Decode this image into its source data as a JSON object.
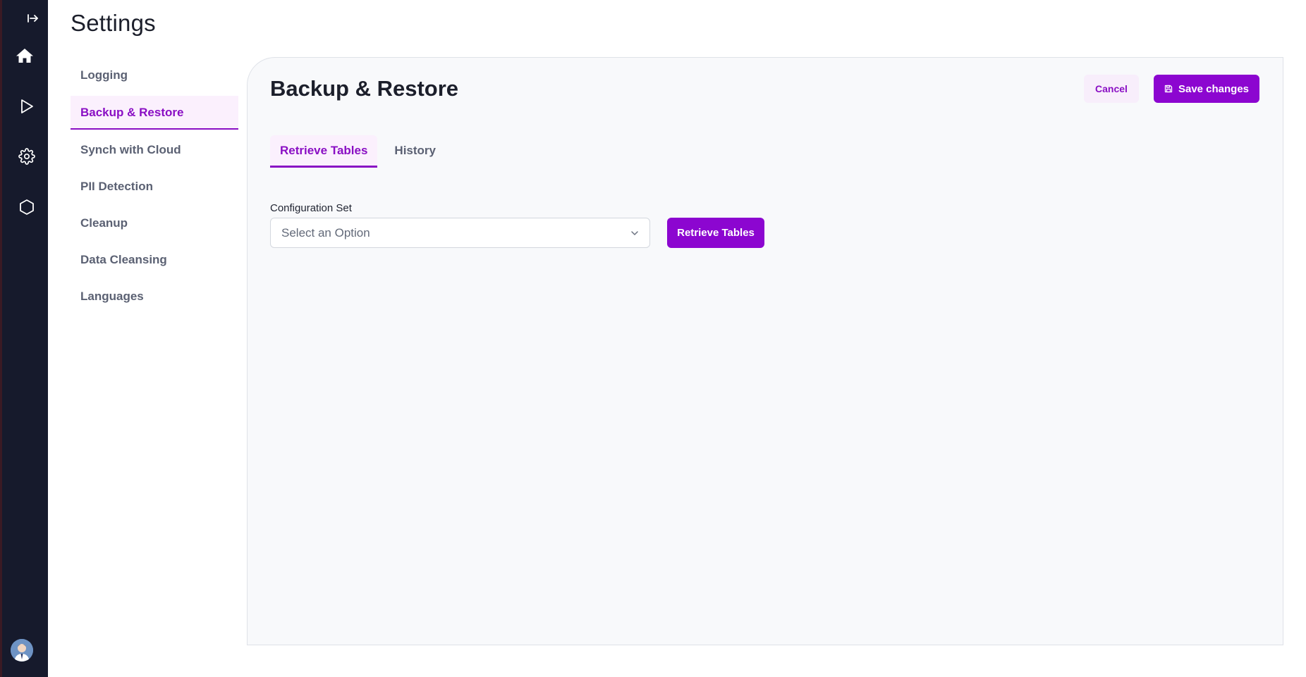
{
  "page": {
    "title": "Settings"
  },
  "rail": {
    "icons": [
      "expand-icon",
      "home-icon",
      "play-icon",
      "gear-icon",
      "hexagon-icon",
      "user-avatar"
    ]
  },
  "settings_nav": {
    "items": [
      {
        "label": "Logging",
        "active": false
      },
      {
        "label": "Backup & Restore",
        "active": true
      },
      {
        "label": "Synch with Cloud",
        "active": false
      },
      {
        "label": "PII Detection",
        "active": false
      },
      {
        "label": "Cleanup",
        "active": false
      },
      {
        "label": "Data Cleansing",
        "active": false
      },
      {
        "label": "Languages",
        "active": false
      }
    ]
  },
  "panel": {
    "title": "Backup & Restore",
    "cancel_label": "Cancel",
    "save_label": "Save changes",
    "tabs": [
      {
        "label": "Retrieve Tables",
        "active": true
      },
      {
        "label": "History",
        "active": false
      }
    ],
    "config_set": {
      "label": "Configuration Set",
      "placeholder": "Select an Option"
    },
    "retrieve_label": "Retrieve Tables"
  },
  "colors": {
    "accent": "#8c06d0",
    "accent_soft": "#fbf0fd",
    "rail_bg": "#161a2c",
    "panel_bg": "#f8f9fb"
  }
}
